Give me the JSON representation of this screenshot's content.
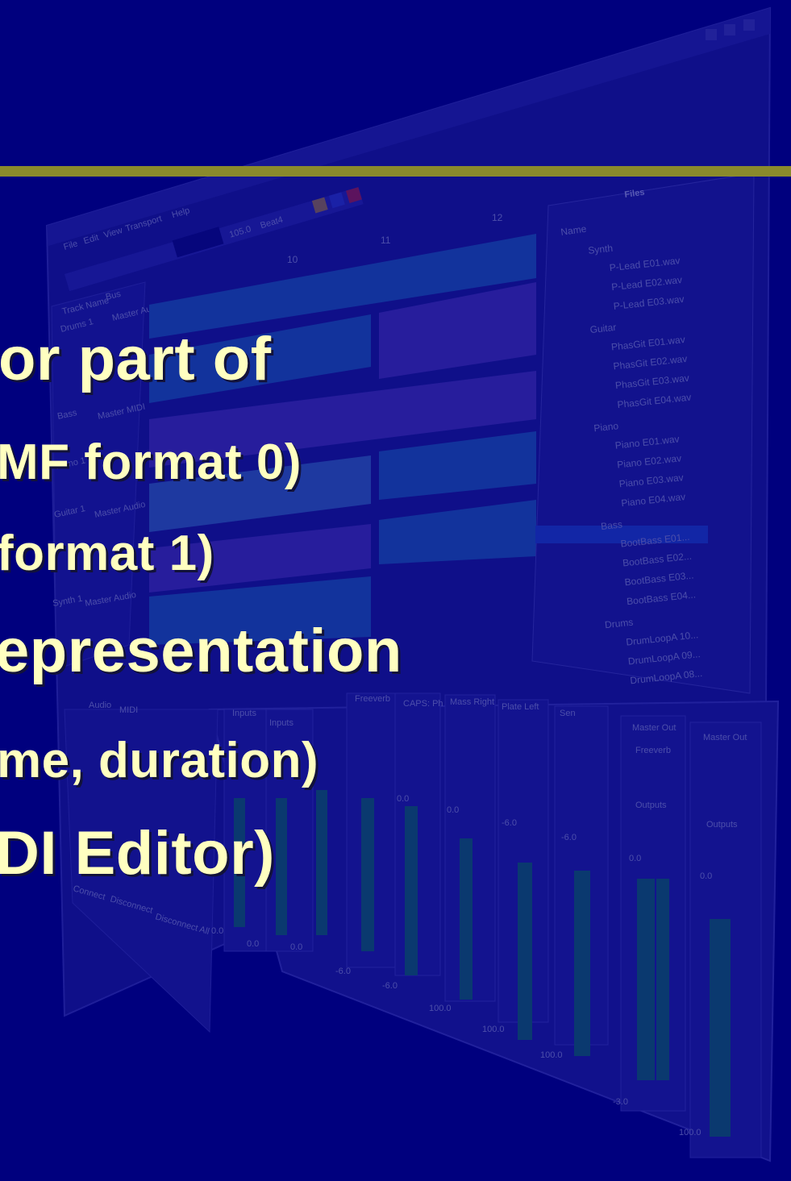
{
  "slide": {
    "bullets": [
      "or part of",
      "MF format 0)",
      "format 1)",
      "epresentation",
      "me, duration)",
      "DI Editor)"
    ]
  },
  "background": {
    "menu": [
      "File",
      "Edit",
      "View",
      "Transport",
      "Help"
    ],
    "tempo": "105.0",
    "signature": "Beat4",
    "ruler": [
      "10",
      "11",
      "12"
    ],
    "tracks": [
      "Track Name",
      "Drums 1",
      "Bass",
      "Piano 1",
      "Guitar 1",
      "Synth 1"
    ],
    "track_io": [
      "Bus",
      "Master Audio",
      "Master MIDI",
      "Master Audio",
      "Master Audio",
      "Master Audio"
    ],
    "files_title": "Files",
    "files_header": "Name",
    "files": [
      {
        "label": "Synth",
        "folder": true
      },
      {
        "label": "P-Lead E01.wav",
        "folder": false
      },
      {
        "label": "P-Lead E02.wav",
        "folder": false
      },
      {
        "label": "P-Lead E03.wav",
        "folder": false
      },
      {
        "label": "Guitar",
        "folder": true
      },
      {
        "label": "PhasGit E01.wav",
        "folder": false
      },
      {
        "label": "PhasGit E02.wav",
        "folder": false
      },
      {
        "label": "PhasGit E03.wav",
        "folder": false
      },
      {
        "label": "PhasGit E04.wav",
        "folder": false
      },
      {
        "label": "Piano",
        "folder": true
      },
      {
        "label": "Piano E01.wav",
        "folder": false
      },
      {
        "label": "Piano E02.wav",
        "folder": false
      },
      {
        "label": "Piano E03.wav",
        "folder": false
      },
      {
        "label": "Piano E04.wav",
        "folder": false
      },
      {
        "label": "Bass",
        "folder": true
      },
      {
        "label": "BootBass E01...",
        "folder": false,
        "selected": true
      },
      {
        "label": "BootBass E02...",
        "folder": false
      },
      {
        "label": "BootBass E03...",
        "folder": false
      },
      {
        "label": "BootBass E04...",
        "folder": false
      },
      {
        "label": "Drums",
        "folder": true
      },
      {
        "label": "DrumLoopA 10...",
        "folder": false
      },
      {
        "label": "DrumLoopA 09...",
        "folder": false
      },
      {
        "label": "DrumLoopA 08...",
        "folder": false
      }
    ],
    "mixer": {
      "tabs": [
        "Audio",
        "MIDI"
      ],
      "strips": [
        "Inputs",
        "Inputs",
        "Freeverb",
        "CAPS: Ph",
        "Mass Right",
        "Plate Left",
        "Sen",
        "Master Out",
        "Master Out"
      ],
      "gain": [
        "0.0",
        "0.0",
        "-6.0",
        "-6.0",
        "0.0",
        "0.0",
        "0.0",
        "0.0",
        "0.0"
      ],
      "volume": [
        "-6.0",
        "-6.0",
        "100.0",
        "100.0",
        "100.0",
        "-3.0",
        "100.0"
      ],
      "outputs": "Outputs",
      "reverb": "Freeverb",
      "buttons": [
        "Connect",
        "Disconnect",
        "Disconnect All"
      ]
    },
    "colors": {
      "background": "#00007e",
      "rule": "#8a8a2c",
      "text": "#ffffc0",
      "audio_clip": "#2f7ec8",
      "midi_clip": "#6048c8",
      "selection": "#2c5ee0"
    }
  }
}
